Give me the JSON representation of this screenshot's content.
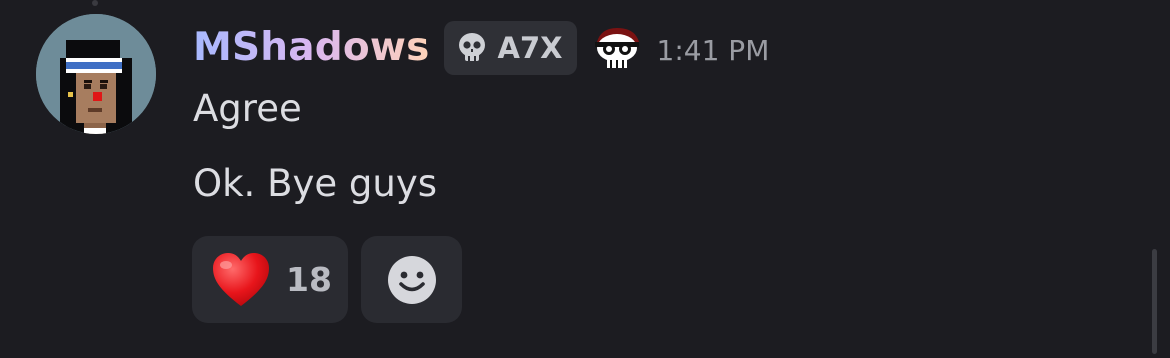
{
  "message": {
    "author": "MShadows",
    "tag": {
      "icon": "skull-icon",
      "label": "A7X"
    },
    "role_icon": "deathbat-skull-icon",
    "timestamp": "1:41 PM",
    "lines": [
      "Agree",
      "Ok. Bye guys"
    ]
  },
  "reactions": [
    {
      "emoji": "heart-emoji",
      "count": "18"
    }
  ],
  "add_reaction": {
    "icon": "smiley-face-icon"
  },
  "colors": {
    "background": "#1c1c21",
    "reaction_bg": "#2a2b31",
    "tag_bg": "#2f3036",
    "username_gradient": [
      "#a8b9ff",
      "#d9b7f0",
      "#ffd3b8"
    ]
  }
}
